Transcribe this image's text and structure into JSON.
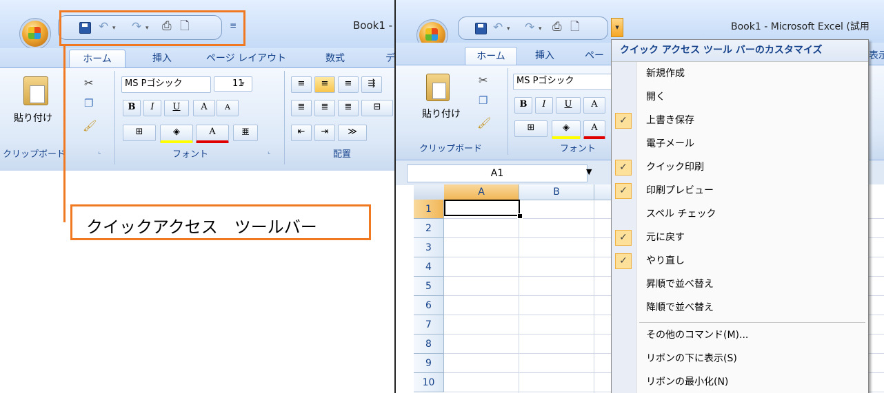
{
  "left": {
    "title": "Book1 -",
    "tabs": [
      "ホーム",
      "挿入",
      "ページ レイアウト",
      "数式",
      "デー"
    ],
    "paste_label": "貼り付け",
    "font_name": "MS Pゴシック",
    "font_size": "11",
    "groups": [
      "クリップボード",
      "フォント",
      "配置"
    ]
  },
  "callout": {
    "label": "クイックアクセス　ツールバー",
    "color": "#f07820"
  },
  "right": {
    "title": "Book1 - Microsoft Excel (試用",
    "tabs": [
      "ホーム",
      "挿入",
      "ペー",
      "表示"
    ],
    "paste_label": "貼り付け",
    "font_name": "MS Pゴシック",
    "groups": [
      "クリップボード",
      "フォント"
    ],
    "name_box": "A1",
    "columns": [
      "A",
      "B"
    ],
    "rows": [
      "1",
      "2",
      "3",
      "4",
      "5",
      "6",
      "7",
      "8",
      "9",
      "10"
    ]
  },
  "menu": {
    "title": "クイック アクセス ツール バーのカスタマイズ",
    "items": [
      {
        "label": "新規作成",
        "checked": false
      },
      {
        "label": "開く",
        "checked": false
      },
      {
        "label": "上書き保存",
        "checked": true
      },
      {
        "label": "電子メール",
        "checked": false
      },
      {
        "label": "クイック印刷",
        "checked": true
      },
      {
        "label": "印刷プレビュー",
        "checked": true
      },
      {
        "label": "スペル チェック",
        "checked": false
      },
      {
        "label": "元に戻す",
        "checked": true
      },
      {
        "label": "やり直し",
        "checked": true
      },
      {
        "label": "昇順で並べ替え",
        "checked": false
      },
      {
        "label": "降順で並べ替え",
        "checked": false
      },
      {
        "label": "その他のコマンド(M)...",
        "checked": false
      },
      {
        "label": "リボンの下に表示(S)",
        "checked": false
      },
      {
        "label": "リボンの最小化(N)",
        "checked": false
      }
    ],
    "check_mark": "✓"
  },
  "colors": {
    "accent_orange": "#f07820",
    "ribbon_blue": "#c5dbf7",
    "check_bg": "#fde19a"
  }
}
